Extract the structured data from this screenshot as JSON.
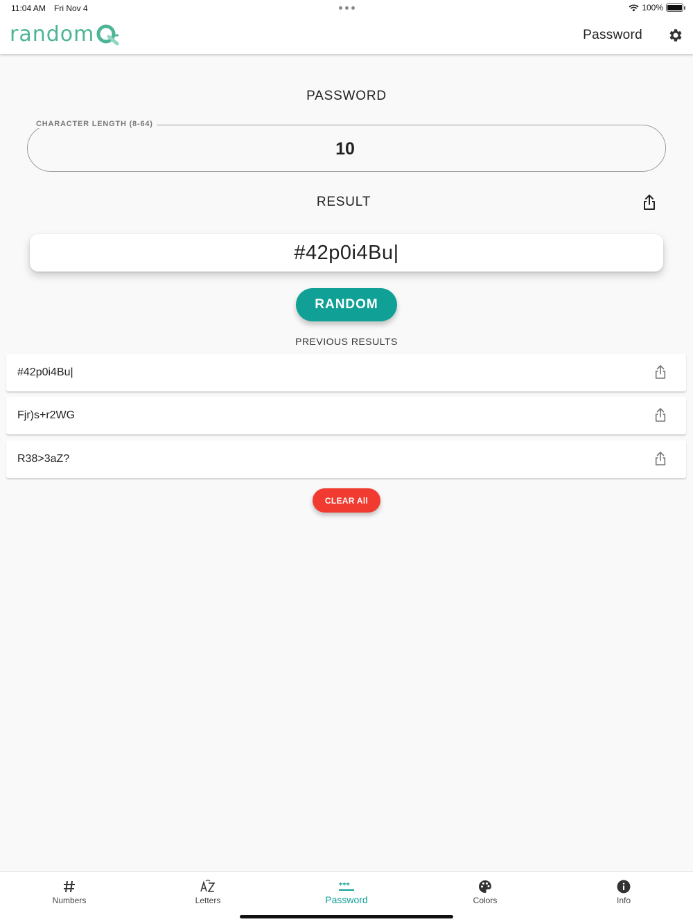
{
  "status_bar": {
    "time": "11:04 AM",
    "date": "Fri Nov 4",
    "battery": "100%"
  },
  "header": {
    "logo_text": "random",
    "title": "Password",
    "accent_color": "#4db596"
  },
  "main": {
    "section_title": "PASSWORD",
    "length_label": "CHARACTER LENGTH (8-64)",
    "length_value": "10",
    "result_title": "RESULT",
    "result_value": "#42p0i4Bu|",
    "random_label": "RANDOM",
    "previous_title": "PREVIOUS RESULTS",
    "history": [
      "#42p0i4Bu|",
      "Fjr)s+r2WG",
      "R38>3aZ?"
    ],
    "clear_label": "CLEAR All"
  },
  "colors": {
    "primary": "#10a095",
    "danger": "#f13b30"
  },
  "nav": {
    "items": [
      {
        "label": "Numbers",
        "icon": "hash-icon"
      },
      {
        "label": "Letters",
        "icon": "az-icon"
      },
      {
        "label": "Password",
        "icon": "password-icon",
        "active": true
      },
      {
        "label": "Colors",
        "icon": "palette-icon"
      },
      {
        "label": "Info",
        "icon": "info-icon"
      }
    ]
  }
}
